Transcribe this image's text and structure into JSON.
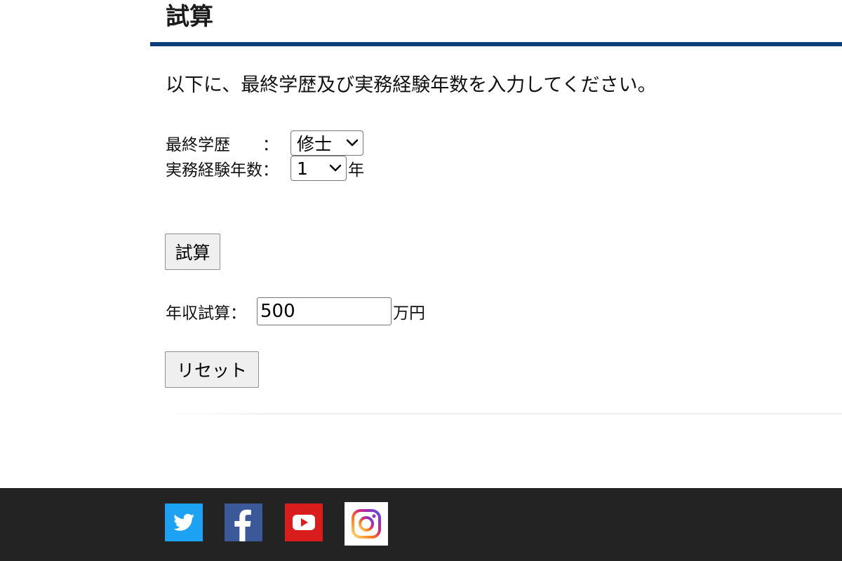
{
  "page": {
    "title": "試算",
    "intro": "以下に、最終学歴及び実務経験年数を入力してください。"
  },
  "form": {
    "education_label": "最終学歴　　：",
    "education_selected": "修士",
    "experience_label": "実務経験年数：",
    "experience_selected": "1",
    "experience_unit": "年",
    "calculate_button": "試算",
    "income_label": "年収試算：",
    "income_value": "500",
    "income_unit": "万円",
    "reset_button": "リセット"
  },
  "footer": {
    "social_icons": [
      "twitter-icon",
      "facebook-icon",
      "youtube-icon",
      "instagram-icon"
    ]
  },
  "colors": {
    "accent_rule": "#0a3d7a",
    "footer_bg": "#232323",
    "twitter": "#1da1f2",
    "facebook": "#3b5998",
    "youtube": "#d91c1c"
  }
}
